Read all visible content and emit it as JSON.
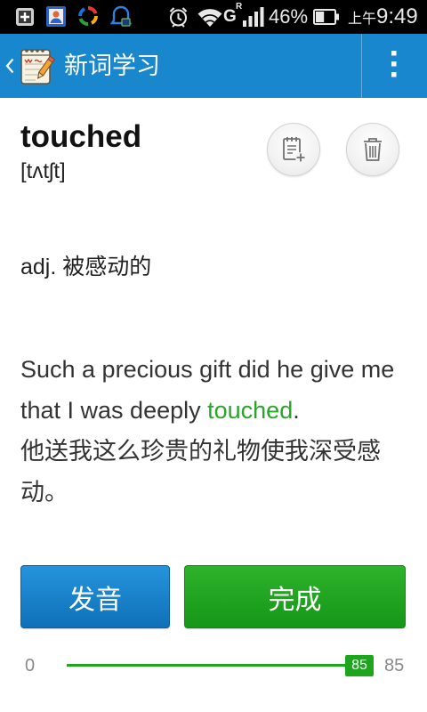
{
  "status_bar": {
    "notification_icons": [
      "add-box-icon",
      "contact-icon",
      "sync-app-icon",
      "notification-app-icon"
    ],
    "alarm_icon": "alarm-icon",
    "wifi_icon": "wifi-icon",
    "network_type": "G",
    "roaming_flag": "R",
    "signal_icon": "signal-icon",
    "battery_icon": "battery-icon",
    "battery_percent": "46%",
    "time_period": "上午",
    "time": "9:49"
  },
  "app_bar": {
    "back_icon": "back-chevron-icon",
    "app_icon": "notepad-pencil-app-icon",
    "title": "新词学习",
    "menu_icon": "overflow-menu-icon"
  },
  "word": {
    "headword": "touched",
    "phonetic": "[tʌtʃt]",
    "definition": "adj. 被感动的",
    "example": {
      "before": "Such a precious gift did he give me that I was deeply ",
      "highlight": "touched",
      "after": ".",
      "translation": "他送我这么珍贵的礼物使我深受感动。"
    }
  },
  "actions": {
    "add_to_notebook_icon": "note-add-icon",
    "delete_icon": "trash-icon",
    "pronounce_label": "发音",
    "done_label": "完成"
  },
  "progress": {
    "min_label": "0",
    "max_label": "85",
    "current": 85,
    "current_label": "85"
  },
  "colors": {
    "status_bar": "#000000",
    "app_bar": "#1987cd",
    "highlight": "#2aa52a",
    "progress": "#1ea51e",
    "muted_text": "#8a8a8a"
  }
}
